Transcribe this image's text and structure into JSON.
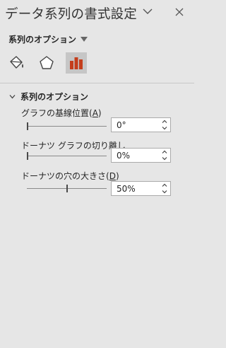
{
  "pane": {
    "title": "データ系列の書式設定",
    "options_dropdown": "系列のオプション"
  },
  "tabs": [
    {
      "name": "fill-line",
      "icon": "paint-bucket-icon",
      "selected": false
    },
    {
      "name": "effects",
      "icon": "pentagon-icon",
      "selected": false
    },
    {
      "name": "series-options",
      "icon": "bar-chart-icon",
      "selected": true
    }
  ],
  "section": {
    "title": "系列のオプション",
    "expanded": true
  },
  "rows": [
    {
      "label_pre": "グラフの基線位置(",
      "accel": "A",
      "label_post": ")",
      "value": "0°",
      "slider_fraction": 0.0
    },
    {
      "label_pre": "ドーナツ グラフの切り離し",
      "accel": "",
      "label_post": "",
      "value": "0%",
      "slider_fraction": 0.0
    },
    {
      "label_pre": "ドーナツの穴の大きさ(",
      "accel": "D",
      "label_post": ")",
      "value": "50%",
      "slider_fraction": 0.5
    }
  ],
  "colors": {
    "pane_bg": "#e6e6e6",
    "accent": "#c43e1c",
    "selected_tab_bg": "#c6c6c6"
  }
}
